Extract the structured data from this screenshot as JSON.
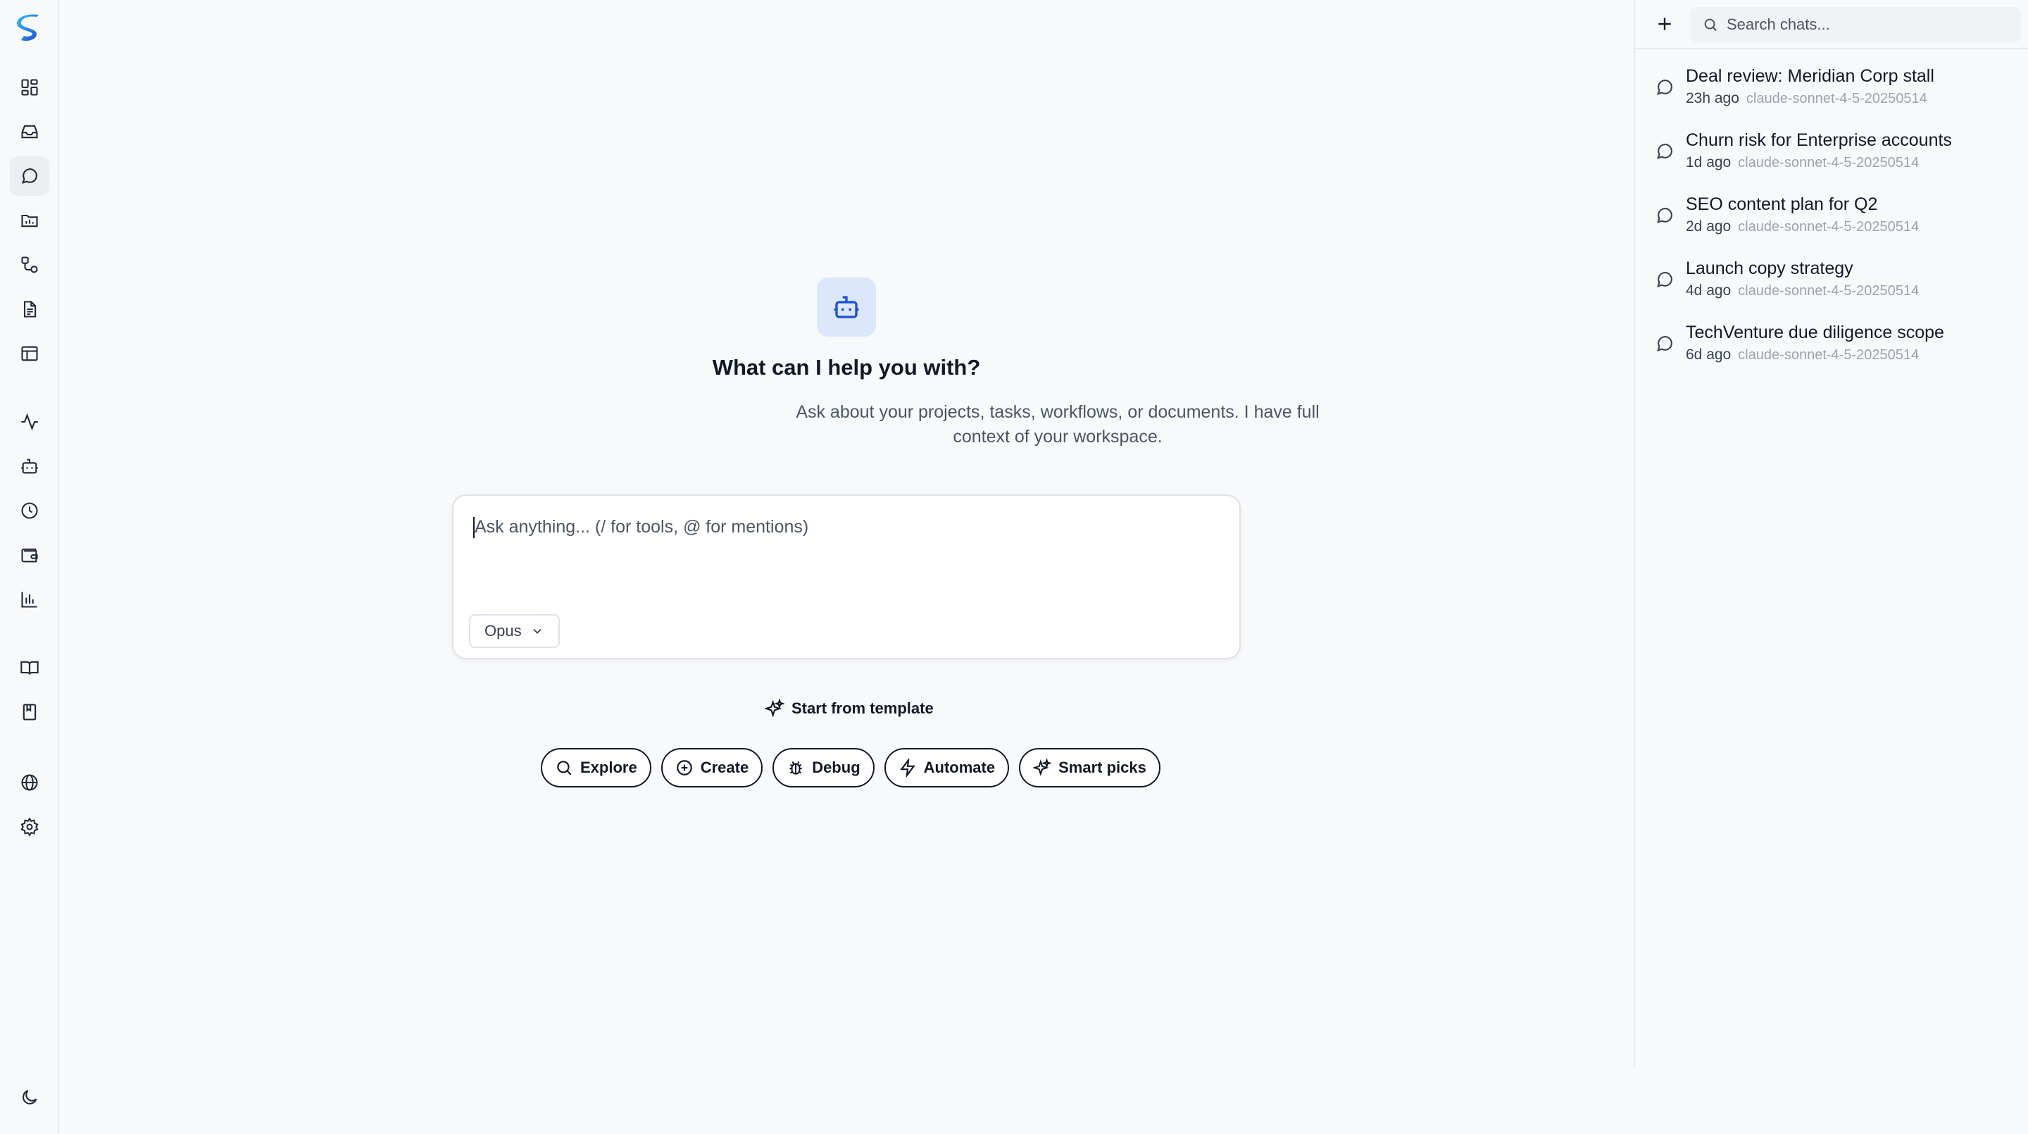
{
  "colors": {
    "accent": "#1d4ed8",
    "badge_bg": "#dbe7fb",
    "background": "#f8f9fb",
    "border": "#e7e9ee"
  },
  "rail": {
    "items": [
      {
        "icon": "dashboard-icon"
      },
      {
        "icon": "inbox-icon"
      },
      {
        "icon": "chat-icon",
        "active": true
      },
      {
        "icon": "folder-chart-icon"
      },
      {
        "icon": "workflow-icon"
      },
      {
        "icon": "document-icon"
      },
      {
        "icon": "table-icon"
      },
      {
        "icon": "activity-icon"
      },
      {
        "icon": "bot-icon"
      },
      {
        "icon": "clock-icon"
      },
      {
        "icon": "wallet-icon"
      },
      {
        "icon": "bar-chart-icon"
      },
      {
        "icon": "book-open-icon"
      },
      {
        "icon": "notebook-icon"
      },
      {
        "icon": "globe-icon"
      },
      {
        "icon": "settings-icon"
      },
      {
        "icon": "moon-icon"
      }
    ]
  },
  "hero": {
    "title": "What can I help you with?",
    "subtitle": "Ask about your projects, tasks, workflows, or documents. I have full context of your workspace."
  },
  "composer": {
    "placeholder": "Ask anything... (/ for tools, @ for mentions)",
    "model": "Opus"
  },
  "template_link": "Start from template",
  "chips": [
    {
      "label": "Explore",
      "icon": "search-icon"
    },
    {
      "label": "Create",
      "icon": "plus-circle-icon"
    },
    {
      "label": "Debug",
      "icon": "bug-icon"
    },
    {
      "label": "Automate",
      "icon": "lightning-icon"
    },
    {
      "label": "Smart picks",
      "icon": "sparkles-icon"
    }
  ],
  "panel": {
    "search_placeholder": "Search chats...",
    "chats": [
      {
        "title": "Deal review: Meridian Corp stall",
        "time": "23h ago",
        "model": "claude-sonnet-4-5-20250514"
      },
      {
        "title": "Churn risk for Enterprise accounts",
        "time": "1d ago",
        "model": "claude-sonnet-4-5-20250514"
      },
      {
        "title": "SEO content plan for Q2",
        "time": "2d ago",
        "model": "claude-sonnet-4-5-20250514"
      },
      {
        "title": "Launch copy strategy",
        "time": "4d ago",
        "model": "claude-sonnet-4-5-20250514"
      },
      {
        "title": "TechVenture due diligence scope",
        "time": "6d ago",
        "model": "claude-sonnet-4-5-20250514"
      }
    ]
  }
}
